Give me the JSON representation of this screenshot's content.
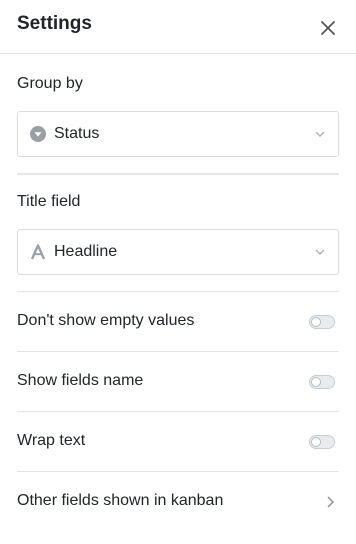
{
  "header": {
    "title": "Settings"
  },
  "group_by": {
    "label": "Group by",
    "value": "Status",
    "icon": "single-select-icon"
  },
  "title_field": {
    "label": "Title field",
    "value": "Headline",
    "icon": "text-type-icon"
  },
  "options": [
    {
      "label": "Don't show empty values",
      "enabled": false
    },
    {
      "label": "Show fields name",
      "enabled": false
    },
    {
      "label": "Wrap text",
      "enabled": false
    }
  ],
  "other_fields": {
    "label": "Other fields shown in kanban"
  },
  "colors": {
    "border": "#e4e4e4",
    "text": "#212529",
    "icon": "#9aa0a6"
  }
}
